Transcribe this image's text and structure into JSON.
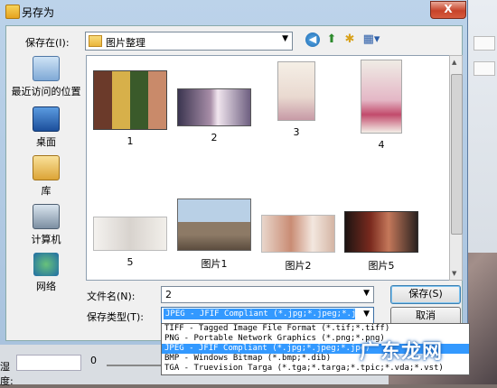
{
  "dialog": {
    "title": "另存为",
    "close_label": "X"
  },
  "toolbar": {
    "save_in_label": "保存在(I):",
    "save_in_value": "图片整理",
    "back_icon": "back-arrow-icon",
    "up_icon": "up-folder-icon",
    "new_folder_icon": "new-folder-icon",
    "view_icon": "view-menu-icon"
  },
  "places": [
    {
      "label": "最近访问的位置",
      "icon": "recent-places-icon"
    },
    {
      "label": "桌面",
      "icon": "desktop-icon"
    },
    {
      "label": "库",
      "icon": "library-icon"
    },
    {
      "label": "计算机",
      "icon": "computer-icon"
    },
    {
      "label": "网络",
      "icon": "network-icon"
    }
  ],
  "files": [
    {
      "name": "1"
    },
    {
      "name": "2"
    },
    {
      "name": "3"
    },
    {
      "name": "4"
    },
    {
      "name": "5"
    },
    {
      "name": "图片1"
    },
    {
      "name": "图片2"
    },
    {
      "name": "图片5"
    }
  ],
  "filename": {
    "label": "文件名(N):",
    "value": "2"
  },
  "filetype": {
    "label": "保存类型(T):",
    "selected": "JPEG - JFIF Compliant (*.jpg;*.jpeg;*.jpe)",
    "options": [
      "TIFF - Tagged Image File Format (*.tif;*.tiff)",
      "PNG - Portable Network Graphics (*.png;*.png)",
      "JPEG - JFIF Compliant (*.jpg;*.jpeg;*.jpe)",
      "BMP - Windows Bitmap (*.bmp;*.dib)",
      "TGA - Truevision Targa (*.tga;*.targa;*.tpic;*.vda;*.vst)"
    ],
    "selected_index": 2
  },
  "buttons": {
    "save": "保存(S)",
    "cancel": "取消"
  },
  "background": {
    "side_label": "湿度:",
    "spin_value": "0"
  },
  "watermark": "广东龙网",
  "colors": {
    "selection": "#3399ff",
    "close_button": "#c7432a"
  }
}
